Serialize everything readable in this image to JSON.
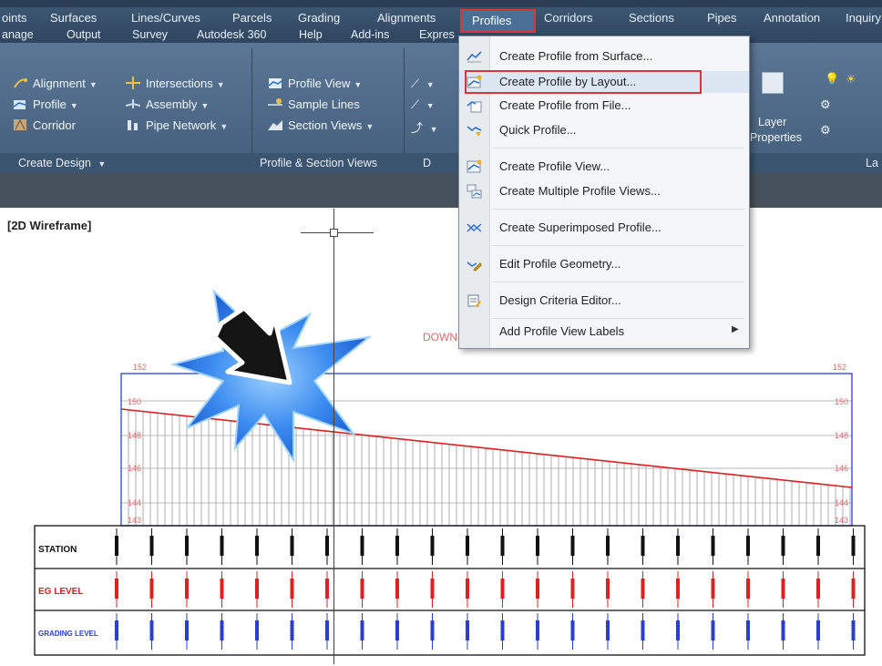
{
  "menubar": {
    "tabs_row1": [
      "oints",
      "Surfaces",
      "Lines/Curves",
      "Parcels",
      "Grading",
      "Alignments",
      "Corridors",
      "Sections",
      "Pipes",
      "Annotation",
      "Inquiry"
    ],
    "active_tab": "Profiles",
    "tabs_row2": [
      "anage",
      "Output",
      "Survey",
      "Autodesk 360",
      "Help",
      "Add-ins",
      "Expres"
    ]
  },
  "ribbon": {
    "create_design": {
      "alignment": "Alignment",
      "intersections": "Intersections",
      "profile": "Profile",
      "assembly": "Assembly",
      "corridor": "Corridor",
      "pipe_network": "Pipe Network",
      "panel_label": "Create Design"
    },
    "profile_section": {
      "profile_view": "Profile View",
      "sample_lines": "Sample Lines",
      "section_views": "Section Views",
      "panel_label": "Profile & Section Views"
    },
    "draw_panel_label": "D",
    "layers": {
      "layer_properties_1": "Layer",
      "layer_properties_2": "Properties",
      "panel_label": "La"
    }
  },
  "dropdown": {
    "items": [
      "Create Profile from Surface...",
      "Create Profile by Layout...",
      "Create Profile from File...",
      "Quick Profile...",
      "Create Profile View...",
      "Create Multiple Profile Views...",
      "Create Superimposed Profile...",
      "Edit Profile Geometry...",
      "Design Criteria Editor...",
      "Add Profile View Labels"
    ],
    "highlighted": "Create Profile by Layout..."
  },
  "viewport": {
    "label": "[2D Wireframe]",
    "title_fragment": "DOWN"
  },
  "profile_grid": {
    "elevations_left": [
      "152",
      "150",
      "148",
      "146",
      "144",
      "143"
    ],
    "elevations_right": [
      "152",
      "150",
      "148",
      "146",
      "144",
      "143"
    ],
    "row_labels": [
      "STATION",
      "EG LEVEL",
      "GRADING LEVEL"
    ]
  },
  "colors": {
    "highlight_border": "#d8353a",
    "profile_line": "#e02020",
    "grid_frame": "#2a3fd0"
  }
}
